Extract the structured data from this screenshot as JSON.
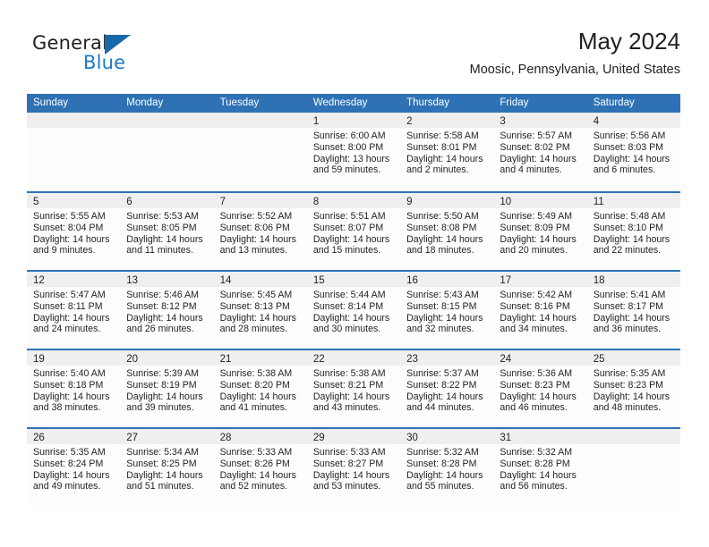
{
  "logo": {
    "word_top": "General",
    "word_bottom": "Blue",
    "triangle_color": "#1769aa",
    "blue_color": "#1e7bc4"
  },
  "header": {
    "title": "May 2024",
    "subtitle": "Moosic, Pennsylvania, United States",
    "accent_color": "#2e72b5",
    "band_color": "#efefef"
  },
  "weekdays": [
    "Sunday",
    "Monday",
    "Tuesday",
    "Wednesday",
    "Thursday",
    "Friday",
    "Saturday"
  ],
  "labels": {
    "sunrise_prefix": "Sunrise:",
    "sunset_prefix": "Sunset:",
    "daylight_prefix": "Daylight:"
  },
  "weeks": [
    [
      {
        "date": "",
        "lines": []
      },
      {
        "date": "",
        "lines": []
      },
      {
        "date": "",
        "lines": []
      },
      {
        "date": "1",
        "lines": [
          "Sunrise: 6:00 AM",
          "Sunset: 8:00 PM",
          "Daylight: 13 hours",
          "and 59 minutes."
        ]
      },
      {
        "date": "2",
        "lines": [
          "Sunrise: 5:58 AM",
          "Sunset: 8:01 PM",
          "Daylight: 14 hours",
          "and 2 minutes."
        ]
      },
      {
        "date": "3",
        "lines": [
          "Sunrise: 5:57 AM",
          "Sunset: 8:02 PM",
          "Daylight: 14 hours",
          "and 4 minutes."
        ]
      },
      {
        "date": "4",
        "lines": [
          "Sunrise: 5:56 AM",
          "Sunset: 8:03 PM",
          "Daylight: 14 hours",
          "and 6 minutes."
        ]
      }
    ],
    [
      {
        "date": "5",
        "lines": [
          "Sunrise: 5:55 AM",
          "Sunset: 8:04 PM",
          "Daylight: 14 hours",
          "and 9 minutes."
        ]
      },
      {
        "date": "6",
        "lines": [
          "Sunrise: 5:53 AM",
          "Sunset: 8:05 PM",
          "Daylight: 14 hours",
          "and 11 minutes."
        ]
      },
      {
        "date": "7",
        "lines": [
          "Sunrise: 5:52 AM",
          "Sunset: 8:06 PM",
          "Daylight: 14 hours",
          "and 13 minutes."
        ]
      },
      {
        "date": "8",
        "lines": [
          "Sunrise: 5:51 AM",
          "Sunset: 8:07 PM",
          "Daylight: 14 hours",
          "and 15 minutes."
        ]
      },
      {
        "date": "9",
        "lines": [
          "Sunrise: 5:50 AM",
          "Sunset: 8:08 PM",
          "Daylight: 14 hours",
          "and 18 minutes."
        ]
      },
      {
        "date": "10",
        "lines": [
          "Sunrise: 5:49 AM",
          "Sunset: 8:09 PM",
          "Daylight: 14 hours",
          "and 20 minutes."
        ]
      },
      {
        "date": "11",
        "lines": [
          "Sunrise: 5:48 AM",
          "Sunset: 8:10 PM",
          "Daylight: 14 hours",
          "and 22 minutes."
        ]
      }
    ],
    [
      {
        "date": "12",
        "lines": [
          "Sunrise: 5:47 AM",
          "Sunset: 8:11 PM",
          "Daylight: 14 hours",
          "and 24 minutes."
        ]
      },
      {
        "date": "13",
        "lines": [
          "Sunrise: 5:46 AM",
          "Sunset: 8:12 PM",
          "Daylight: 14 hours",
          "and 26 minutes."
        ]
      },
      {
        "date": "14",
        "lines": [
          "Sunrise: 5:45 AM",
          "Sunset: 8:13 PM",
          "Daylight: 14 hours",
          "and 28 minutes."
        ]
      },
      {
        "date": "15",
        "lines": [
          "Sunrise: 5:44 AM",
          "Sunset: 8:14 PM",
          "Daylight: 14 hours",
          "and 30 minutes."
        ]
      },
      {
        "date": "16",
        "lines": [
          "Sunrise: 5:43 AM",
          "Sunset: 8:15 PM",
          "Daylight: 14 hours",
          "and 32 minutes."
        ]
      },
      {
        "date": "17",
        "lines": [
          "Sunrise: 5:42 AM",
          "Sunset: 8:16 PM",
          "Daylight: 14 hours",
          "and 34 minutes."
        ]
      },
      {
        "date": "18",
        "lines": [
          "Sunrise: 5:41 AM",
          "Sunset: 8:17 PM",
          "Daylight: 14 hours",
          "and 36 minutes."
        ]
      }
    ],
    [
      {
        "date": "19",
        "lines": [
          "Sunrise: 5:40 AM",
          "Sunset: 8:18 PM",
          "Daylight: 14 hours",
          "and 38 minutes."
        ]
      },
      {
        "date": "20",
        "lines": [
          "Sunrise: 5:39 AM",
          "Sunset: 8:19 PM",
          "Daylight: 14 hours",
          "and 39 minutes."
        ]
      },
      {
        "date": "21",
        "lines": [
          "Sunrise: 5:38 AM",
          "Sunset: 8:20 PM",
          "Daylight: 14 hours",
          "and 41 minutes."
        ]
      },
      {
        "date": "22",
        "lines": [
          "Sunrise: 5:38 AM",
          "Sunset: 8:21 PM",
          "Daylight: 14 hours",
          "and 43 minutes."
        ]
      },
      {
        "date": "23",
        "lines": [
          "Sunrise: 5:37 AM",
          "Sunset: 8:22 PM",
          "Daylight: 14 hours",
          "and 44 minutes."
        ]
      },
      {
        "date": "24",
        "lines": [
          "Sunrise: 5:36 AM",
          "Sunset: 8:23 PM",
          "Daylight: 14 hours",
          "and 46 minutes."
        ]
      },
      {
        "date": "25",
        "lines": [
          "Sunrise: 5:35 AM",
          "Sunset: 8:23 PM",
          "Daylight: 14 hours",
          "and 48 minutes."
        ]
      }
    ],
    [
      {
        "date": "26",
        "lines": [
          "Sunrise: 5:35 AM",
          "Sunset: 8:24 PM",
          "Daylight: 14 hours",
          "and 49 minutes."
        ]
      },
      {
        "date": "27",
        "lines": [
          "Sunrise: 5:34 AM",
          "Sunset: 8:25 PM",
          "Daylight: 14 hours",
          "and 51 minutes."
        ]
      },
      {
        "date": "28",
        "lines": [
          "Sunrise: 5:33 AM",
          "Sunset: 8:26 PM",
          "Daylight: 14 hours",
          "and 52 minutes."
        ]
      },
      {
        "date": "29",
        "lines": [
          "Sunrise: 5:33 AM",
          "Sunset: 8:27 PM",
          "Daylight: 14 hours",
          "and 53 minutes."
        ]
      },
      {
        "date": "30",
        "lines": [
          "Sunrise: 5:32 AM",
          "Sunset: 8:28 PM",
          "Daylight: 14 hours",
          "and 55 minutes."
        ]
      },
      {
        "date": "31",
        "lines": [
          "Sunrise: 5:32 AM",
          "Sunset: 8:28 PM",
          "Daylight: 14 hours",
          "and 56 minutes."
        ]
      },
      {
        "date": "",
        "lines": []
      }
    ]
  ]
}
